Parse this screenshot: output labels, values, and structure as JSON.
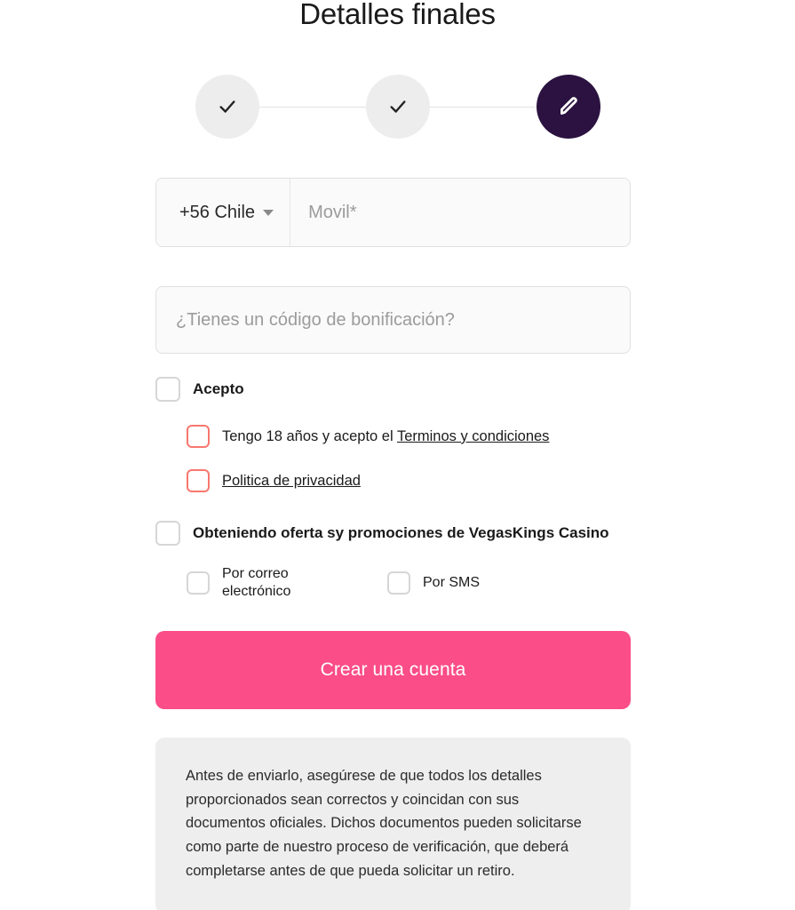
{
  "page": {
    "title": "Detalles finales"
  },
  "stepper": {
    "steps": [
      {
        "state": "completed",
        "icon": "check-icon"
      },
      {
        "state": "completed",
        "icon": "check-icon"
      },
      {
        "state": "active",
        "icon": "pencil-icon"
      }
    ],
    "active_color": "#2B1240",
    "completed_color": "#EDEDED",
    "line_color": "#E2E2E2"
  },
  "phone": {
    "country_code_label": "+56 Chile",
    "dropdown_icon": "chevron-down-icon",
    "input_value": "",
    "input_placeholder": "Movil*"
  },
  "bonus": {
    "value": "",
    "placeholder": "¿Tienes un código de bonificación?"
  },
  "terms": {
    "accept_label": "Acepto",
    "accept_checked": false,
    "age_prefix": "Tengo 18 años y acepto el ",
    "age_link": "Terminos y condiciones",
    "age_checked": false,
    "age_error": true,
    "privacy_link": "Politica de privacidad",
    "privacy_checked": false,
    "privacy_error": true,
    "error_color": "#F8776F"
  },
  "promotions": {
    "label": "Obteniendo oferta sy promociones de VegasKings Casino",
    "checked": false,
    "channels": [
      {
        "label": "Por correo electrónico",
        "checked": false
      },
      {
        "label": "Por SMS",
        "checked": false
      }
    ]
  },
  "submit": {
    "label": "Crear una cuenta",
    "color": "#FB4D87"
  },
  "notice": {
    "text": "Antes de enviarlo, asegúrese de que todos los detalles proporcionados sean correctos y coincidan con sus documentos oficiales. Dichos documentos pueden solicitarse como parte de nuestro proceso de verificación, que deberá completarse antes de que pueda solicitar un retiro.",
    "background": "#EEEEEE"
  }
}
